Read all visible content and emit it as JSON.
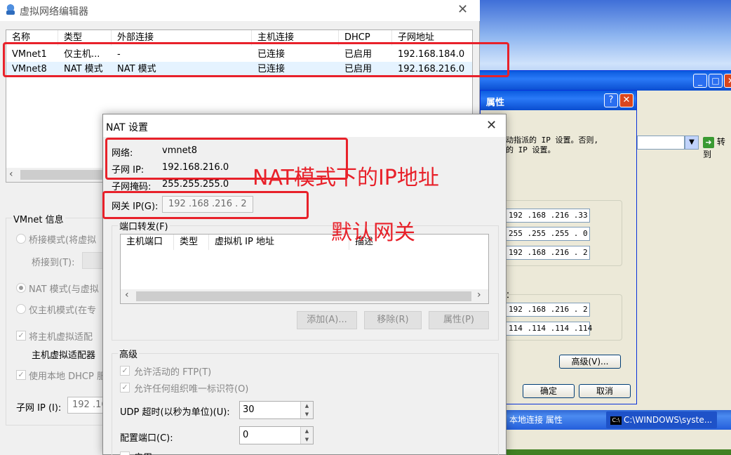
{
  "background": {
    "properties_dialog": {
      "title": "属性",
      "help_glyph": "?",
      "close_glyph": "✕",
      "description": "动指派的 IP 设置。否则,\n的 IP 设置。",
      "ip_address": "192 .168 .216 .33",
      "subnet_mask": "255 .255 .255 . 0",
      "default_gateway": "192 .168 .216 . 2",
      "dns_preferred": "192 .168 .216 . 2",
      "dns_alternate": "114 .114 .114 .114",
      "advanced_label": "高级(V)...",
      "ok_label": "确定",
      "cancel_label": "取消",
      "group_label_fragment": "："
    },
    "go_label": "转到",
    "taskbar": {
      "item1": "本地连接 属性",
      "item2": "C:\\WINDOWS\\syste...",
      "cmd_icon": "C:\\"
    }
  },
  "vne": {
    "title": "虚拟网络编辑器",
    "close_glyph": "✕",
    "columns": [
      "名称",
      "类型",
      "外部连接",
      "主机连接",
      "DHCP",
      "子网地址"
    ],
    "rows": [
      {
        "name": "VMnet1",
        "type": "仅主机...",
        "external": "-",
        "host": "已连接",
        "dhcp": "已启用",
        "subnet": "192.168.184.0"
      },
      {
        "name": "VMnet8",
        "type": "NAT 模式",
        "external": "NAT 模式",
        "host": "已连接",
        "dhcp": "已启用",
        "subnet": "192.168.216.0"
      }
    ],
    "info": {
      "legend": "VMnet 信息",
      "bridged": "桥接模式(将虚拟",
      "bridge_to": "桥接到(T):",
      "nat": "NAT 模式(与虚拟",
      "hostonly": "仅主机模式(在专",
      "connect_adapter": "将主机虚拟适配",
      "adapter_name": "主机虚拟适配器",
      "use_dhcp": "使用本地 DHCP 服",
      "subnet_ip_label": "子网 IP (I):",
      "subnet_ip_value": "192 .16"
    }
  },
  "nat": {
    "title": "NAT 设置",
    "close_glyph": "✕",
    "network_label": "网络:",
    "network_value": "vmnet8",
    "subnet_ip_label": "子网 IP:",
    "subnet_ip_value": "192.168.216.0",
    "subnet_mask_label": "子网掩码:",
    "subnet_mask_value": "255.255.255.0",
    "gateway_label": "网关 IP(G):",
    "gateway_value": "192 .168 .216 . 2",
    "port_forward_legend": "端口转发(F)",
    "pf_columns": [
      "主机端口",
      "类型",
      "虚拟机 IP 地址",
      "描述"
    ],
    "add_label": "添加(A)...",
    "remove_label": "移除(R)",
    "props_label": "属性(P)",
    "advanced_legend": "高级",
    "allow_ftp": "允许活动的 FTP(T)",
    "allow_oui": "允许任何组织唯一标识符(O)",
    "udp_timeout_label": "UDP 超时(以秒为单位)(U):",
    "udp_timeout_value": "30",
    "config_port_label": "配置端口(C):",
    "config_port_value": "0",
    "enable_label": "启用"
  },
  "annotations": {
    "nat_ip": "NAT模式下的IP地址",
    "default_gateway": "默认网关"
  },
  "colors": {
    "annotation_red": "#e8212a",
    "xp_title_blue": "#0a5adf",
    "selected_row": "#e5f3ff"
  }
}
